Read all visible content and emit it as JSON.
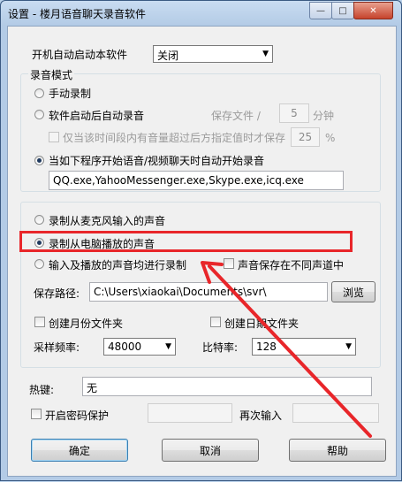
{
  "window": {
    "title": "设置 - 楼月语音聊天录音软件",
    "min_glyph": "—",
    "max_glyph": "□",
    "close_glyph": "✕"
  },
  "startup": {
    "label": "开机自动启动本软件",
    "value": "关闭"
  },
  "record_mode": {
    "group_title": "录音模式",
    "manual": "手动录制",
    "auto_on_start": "软件启动后自动录音",
    "save_file_label": "保存文件 /",
    "save_minutes": "5",
    "minutes_unit": "分钟",
    "only_when_volume": "仅当该时间段内有音量超过后方指定值时才保存",
    "volume_value": "25",
    "percent": "%",
    "auto_on_programs": "当如下程序开始语音/视频聊天时自动开始录音",
    "programs": "QQ.exe,YahooMessenger.exe,Skype.exe,icq.exe"
  },
  "source": {
    "mic": "录制从麦克风输入的声音",
    "speaker": "录制从电脑播放的声音",
    "both": "输入及播放的声音均进行录制",
    "diff_channel": "声音保存在不同声道中",
    "path_label": "保存路径:",
    "path_value": "C:\\Users\\xiaokai\\Documents\\svr\\",
    "browse": "浏览",
    "monthly_folder": "创建月份文件夹",
    "daily_folder": "创建日期文件夹",
    "sample_label": "采样频率:",
    "sample_value": "48000",
    "bitrate_label": "比特率:",
    "bitrate_value": "128"
  },
  "hotkey": {
    "label": "热键:",
    "value": "无"
  },
  "password": {
    "label": "开启密码保护",
    "repeat_label": "再次输入"
  },
  "buttons": {
    "ok": "确定",
    "cancel": "取消",
    "help": "帮助"
  },
  "colors": {
    "highlight": "#e8262a",
    "arrow": "#e8262a"
  }
}
